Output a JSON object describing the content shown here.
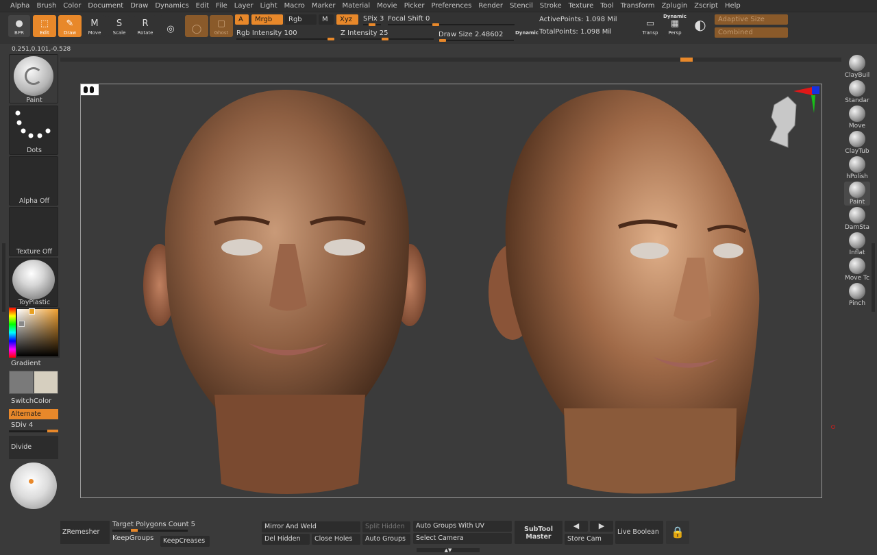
{
  "menu": [
    "Alpha",
    "Brush",
    "Color",
    "Document",
    "Draw",
    "Dynamics",
    "Edit",
    "File",
    "Layer",
    "Light",
    "Macro",
    "Marker",
    "Material",
    "Movie",
    "Picker",
    "Preferences",
    "Render",
    "Stencil",
    "Stroke",
    "Texture",
    "Tool",
    "Transform",
    "Zplugin",
    "Zscript",
    "Help"
  ],
  "toolbar": {
    "bpr": "BPR",
    "edit": "Edit",
    "draw": "Draw",
    "move": "Move",
    "scale": "Scale",
    "rotate": "Rotate",
    "ghost": "Ghost",
    "a": "A",
    "mrgb": "Mrgb",
    "rgb": "Rgb",
    "m": "M",
    "xyz": "Xyz",
    "spix_label": "SPix",
    "spix_value": "3",
    "focal_label": "Focal Shift",
    "focal_value": "0",
    "rgb_intensity_label": "Rgb Intensity",
    "rgb_intensity_value": "100",
    "z_intensity_label": "Z Intensity",
    "z_intensity_value": "25",
    "draw_size_label": "Draw Size",
    "draw_size_value": "2.48602",
    "dynamic": "Dynamic",
    "active_points": "ActivePoints: 1.098 Mil",
    "total_points": "TotalPoints: 1.098 Mil",
    "transp": "Transp",
    "persp": "Persp",
    "dynamic_persp": "Dynamic",
    "adaptive_size": "Adaptive Size",
    "combined": "Combined"
  },
  "coords": "0.251,0.101,-0.528",
  "left_panel": {
    "brush": "Paint",
    "stroke": "Dots",
    "alpha": "Alpha Off",
    "texture": "Texture Off",
    "material": "ToyPlastic",
    "gradient": "Gradient",
    "switch_color": "SwitchColor",
    "alternate": "Alternate",
    "sdiv": "SDiv 4",
    "divide": "Divide"
  },
  "brushes": [
    "ClayBuil",
    "Standar",
    "Move",
    "ClayTub",
    "hPolish",
    "Paint",
    "DamSta",
    "Inflat",
    "Move Tc",
    "Pinch"
  ],
  "bottom": {
    "zremesher": "ZRemesher",
    "target_polys": "Target Polygons Count 5",
    "keepgroups": "KeepGroups",
    "keepcreases": "KeepCreases",
    "mirror_weld": "Mirror And Weld",
    "split_hidden": "Split Hidden",
    "del_hidden": "Del Hidden",
    "close_holes": "Close Holes",
    "auto_groups": "Auto Groups",
    "auto_groups_uv": "Auto Groups With UV",
    "select_camera": "Select Camera",
    "subtool_master_1": "SubTool",
    "subtool_master_2": "Master",
    "store_cam": "Store Cam",
    "live_boolean": "Live Boolean"
  },
  "colors": {
    "accent": "#e8882a",
    "bg": "#3a3a3a",
    "panel": "#2a2a2a"
  }
}
